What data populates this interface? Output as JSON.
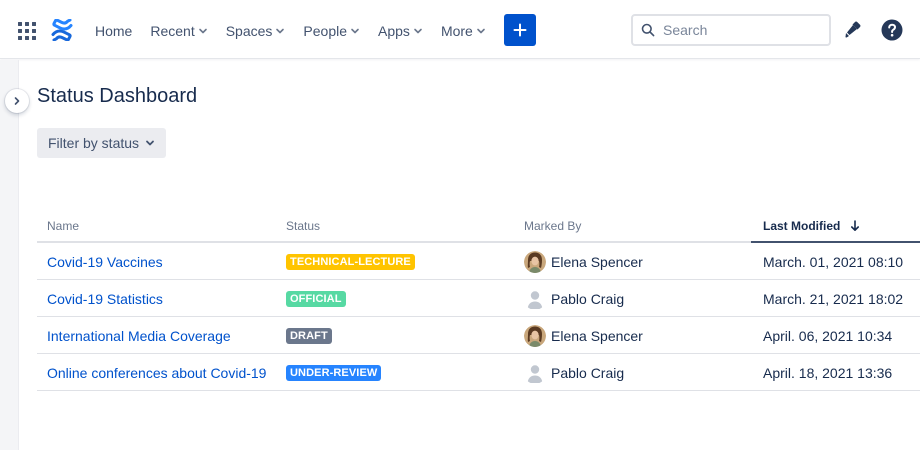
{
  "nav": {
    "items": [
      {
        "label": "Home",
        "has_dropdown": false
      },
      {
        "label": "Recent",
        "has_dropdown": true
      },
      {
        "label": "Spaces",
        "has_dropdown": true
      },
      {
        "label": "People",
        "has_dropdown": true
      },
      {
        "label": "Apps",
        "has_dropdown": true
      },
      {
        "label": "More",
        "has_dropdown": true
      }
    ],
    "search_placeholder": "Search",
    "icons": {
      "app_switcher": "grid-icon",
      "logo": "confluence-logo-icon",
      "create": "plus-icon",
      "search": "search-icon",
      "notifications": "notification-icon",
      "help": "help-icon"
    }
  },
  "page": {
    "title": "Status Dashboard",
    "filter_label": "Filter by status"
  },
  "table": {
    "columns": [
      "Name",
      "Status",
      "Marked By",
      "Last Modified"
    ],
    "sorted_column": "Last Modified",
    "sort_direction": "descending",
    "rows": [
      {
        "name": "Covid-19 Vaccines",
        "status": "TECHNICAL-LECTURE",
        "status_color": "#ffc400",
        "status_text_color": "#ffffff",
        "marked_by": "Elena Spencer",
        "avatar": "photo",
        "modified": "March. 01, 2021 08:10"
      },
      {
        "name": "Covid-19 Statistics",
        "status": "OFFICIAL",
        "status_color": "#57d9a3",
        "status_text_color": "#ffffff",
        "marked_by": "Pablo Craig",
        "avatar": "default",
        "modified": "March. 21, 2021 18:02"
      },
      {
        "name": "International Media Coverage",
        "status": "DRAFT",
        "status_color": "#6b778c",
        "status_text_color": "#ffffff",
        "marked_by": "Elena Spencer",
        "avatar": "photo",
        "modified": "April. 06, 2021 10:34"
      },
      {
        "name": "Online conferences about Covid-19",
        "status": "UNDER-REVIEW",
        "status_color": "#2684ff",
        "status_text_color": "#ffffff",
        "marked_by": "Pablo Craig",
        "avatar": "default",
        "modified": "April. 18, 2021 13:36"
      }
    ]
  },
  "colors": {
    "brand": "#0052cc",
    "link": "#0052cc",
    "text": "#172b4d",
    "muted": "#6b778c"
  }
}
